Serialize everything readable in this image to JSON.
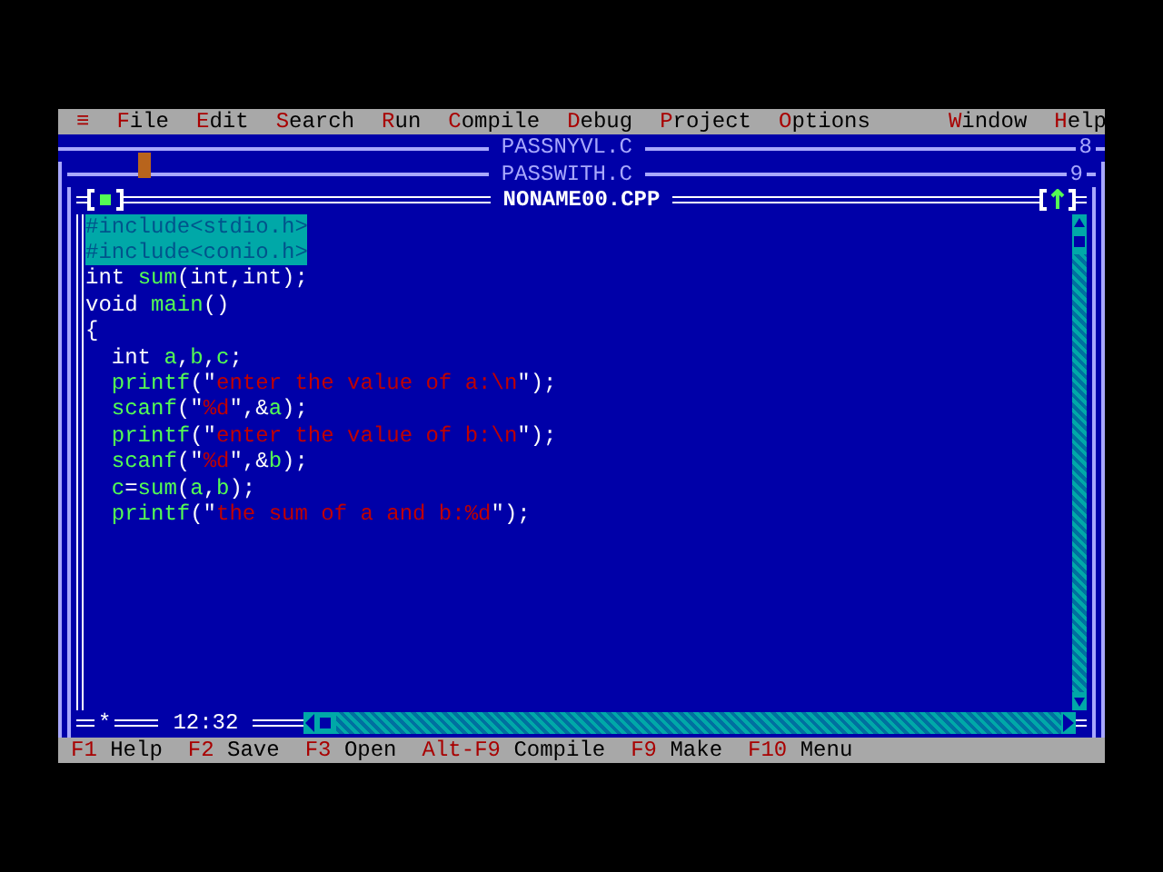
{
  "menu": [
    {
      "hotkey": "≡"
    },
    {
      "hotkey": "F",
      "rest": "ile"
    },
    {
      "hotkey": "E",
      "rest": "dit"
    },
    {
      "hotkey": "S",
      "rest": "earch"
    },
    {
      "hotkey": "R",
      "rest": "un"
    },
    {
      "hotkey": "C",
      "rest": "ompile"
    },
    {
      "hotkey": "D",
      "rest": "ebug"
    },
    {
      "hotkey": "P",
      "rest": "roject"
    },
    {
      "hotkey": "O",
      "rest": "ptions"
    },
    {
      "hotkey": "W",
      "rest": "indow"
    },
    {
      "hotkey": "H",
      "rest": "elp"
    }
  ],
  "back_windows": [
    {
      "title": "PASSNYVL.C",
      "number": "8"
    },
    {
      "title": "PASSWITH.C",
      "number": "9"
    }
  ],
  "editor": {
    "title": "NONAME00.CPP",
    "modified_mark": "*",
    "cursor_position": "12:32",
    "lines": [
      {
        "selected": true,
        "indented": false,
        "tokens": [
          {
            "kind": "plain",
            "text": "#include<stdio.h>"
          }
        ]
      },
      {
        "selected": true,
        "indented": false,
        "tokens": [
          {
            "kind": "plain",
            "text": "#include<conio.h>"
          }
        ]
      },
      {
        "selected": false,
        "indented": false,
        "tokens": [
          {
            "kind": "plain",
            "text": "int "
          },
          {
            "kind": "ident",
            "text": "sum"
          },
          {
            "kind": "plain",
            "text": "(int,int);"
          }
        ]
      },
      {
        "selected": false,
        "indented": false,
        "tokens": [
          {
            "kind": "plain",
            "text": "void "
          },
          {
            "kind": "ident",
            "text": "main"
          },
          {
            "kind": "plain",
            "text": "()"
          }
        ]
      },
      {
        "selected": false,
        "indented": false,
        "tokens": [
          {
            "kind": "plain",
            "text": "{"
          }
        ]
      },
      {
        "selected": false,
        "indented": true,
        "tokens": [
          {
            "kind": "plain",
            "text": "int "
          },
          {
            "kind": "ident",
            "text": "a"
          },
          {
            "kind": "plain",
            "text": ","
          },
          {
            "kind": "ident",
            "text": "b"
          },
          {
            "kind": "plain",
            "text": ","
          },
          {
            "kind": "ident",
            "text": "c"
          },
          {
            "kind": "plain",
            "text": ";"
          }
        ]
      },
      {
        "selected": false,
        "indented": true,
        "tokens": [
          {
            "kind": "ident",
            "text": "printf"
          },
          {
            "kind": "plain",
            "text": "(\""
          },
          {
            "kind": "string",
            "text": "enter the value of a:\\n"
          },
          {
            "kind": "plain",
            "text": "\");"
          }
        ]
      },
      {
        "selected": false,
        "indented": true,
        "tokens": [
          {
            "kind": "ident",
            "text": "scanf"
          },
          {
            "kind": "plain",
            "text": "(\""
          },
          {
            "kind": "string",
            "text": "%d"
          },
          {
            "kind": "plain",
            "text": "\",&"
          },
          {
            "kind": "ident",
            "text": "a"
          },
          {
            "kind": "plain",
            "text": ");"
          }
        ]
      },
      {
        "selected": false,
        "indented": true,
        "tokens": [
          {
            "kind": "ident",
            "text": "printf"
          },
          {
            "kind": "plain",
            "text": "(\""
          },
          {
            "kind": "string",
            "text": "enter the value of b:\\n"
          },
          {
            "kind": "plain",
            "text": "\");"
          }
        ]
      },
      {
        "selected": false,
        "indented": true,
        "tokens": [
          {
            "kind": "ident",
            "text": "scanf"
          },
          {
            "kind": "plain",
            "text": "(\""
          },
          {
            "kind": "string",
            "text": "%d"
          },
          {
            "kind": "plain",
            "text": "\",&"
          },
          {
            "kind": "ident",
            "text": "b"
          },
          {
            "kind": "plain",
            "text": ");"
          }
        ]
      },
      {
        "selected": false,
        "indented": true,
        "tokens": [
          {
            "kind": "ident",
            "text": "c"
          },
          {
            "kind": "plain",
            "text": "="
          },
          {
            "kind": "ident",
            "text": "sum"
          },
          {
            "kind": "plain",
            "text": "("
          },
          {
            "kind": "ident",
            "text": "a"
          },
          {
            "kind": "plain",
            "text": ","
          },
          {
            "kind": "ident",
            "text": "b"
          },
          {
            "kind": "plain",
            "text": ");"
          }
        ]
      },
      {
        "selected": false,
        "indented": true,
        "tokens": [
          {
            "kind": "ident",
            "text": "printf"
          },
          {
            "kind": "plain",
            "text": "(\""
          },
          {
            "kind": "string",
            "text": "the sum of a and b:%d"
          },
          {
            "kind": "plain",
            "text": "\");"
          }
        ]
      }
    ]
  },
  "status_bar": [
    {
      "key": "F1",
      "label": "Help"
    },
    {
      "key": "F2",
      "label": "Save"
    },
    {
      "key": "F3",
      "label": "Open"
    },
    {
      "key": "Alt-F9",
      "label": "Compile"
    },
    {
      "key": "F9",
      "label": "Make"
    },
    {
      "key": "F10",
      "label": "Menu"
    }
  ]
}
